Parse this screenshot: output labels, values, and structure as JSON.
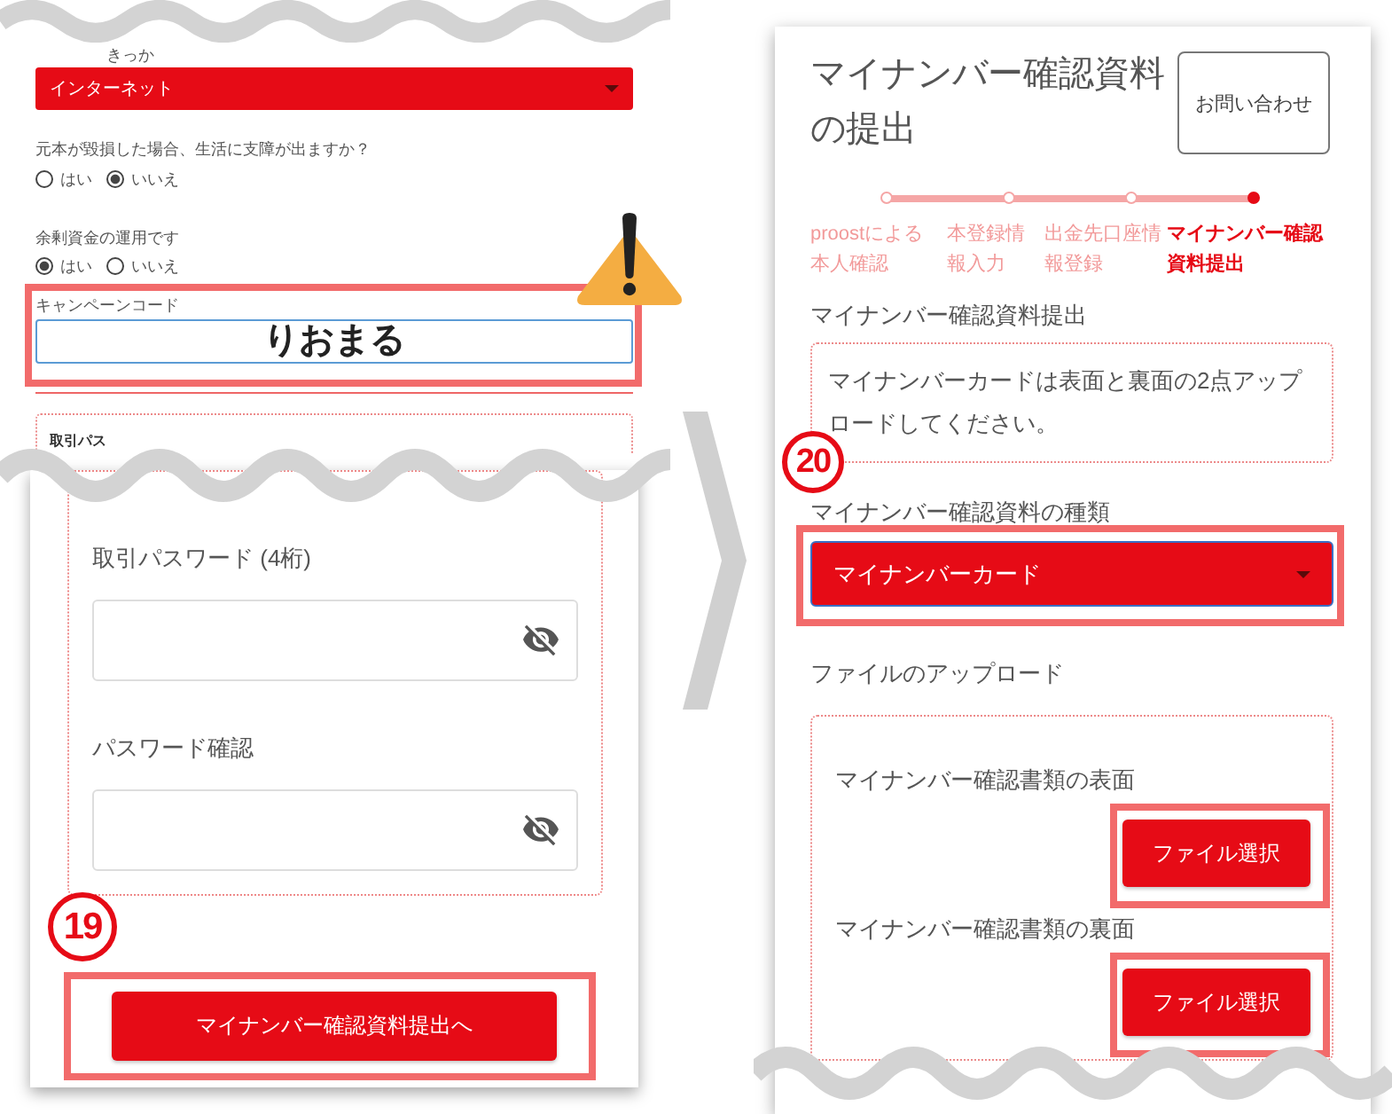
{
  "left_top": {
    "cut_label": "きっか",
    "source_select": {
      "value": "インターネット"
    },
    "questions": [
      {
        "label": "元本が毀損した場合、生活に支障が出ますか？",
        "options": [
          {
            "label": "はい",
            "selected": false
          },
          {
            "label": "いいえ",
            "selected": true
          }
        ]
      },
      {
        "label": "余剰資金の運用です",
        "options": [
          {
            "label": "はい",
            "selected": true
          },
          {
            "label": "いいえ",
            "selected": false
          }
        ]
      }
    ],
    "campaign_code": {
      "label": "キャンペーンコード",
      "value": "りおまる",
      "highlighted": true
    },
    "password_box_cut_label": "取引パス"
  },
  "left_bottom": {
    "fields": [
      {
        "label": "取引パスワード (4桁)"
      },
      {
        "label": "パスワード確認"
      }
    ],
    "step_number": "19",
    "submit_button": {
      "label": "マイナンバー確認資料提出へ",
      "highlighted": true
    }
  },
  "right": {
    "title": "マイナンバー確認資料の提出",
    "contact_button": "お問い合わせ",
    "steps": [
      {
        "label": "proostによる本人確認",
        "selected": false
      },
      {
        "label": "本登録情報入力",
        "selected": false
      },
      {
        "label": "出金先口座情報登録",
        "selected": false
      },
      {
        "label": "マイナンバー確認資料提出",
        "selected": true
      }
    ],
    "section_title": "マイナンバー確認資料提出",
    "notice": "マイナンバーカードは表面と裏面の2点アップロードしてください。",
    "step_number": "20",
    "document_type": {
      "label": "マイナンバー確認資料の種類",
      "value": "マイナンバーカード",
      "highlighted": true
    },
    "upload_title": "ファイルのアップロード",
    "uploads": [
      {
        "label": "マイナンバー確認書類の表面",
        "button": "ファイル選択",
        "highlighted": true
      },
      {
        "label": "マイナンバー確認書類の裏面",
        "button": "ファイル選択",
        "highlighted": true
      }
    ]
  }
}
